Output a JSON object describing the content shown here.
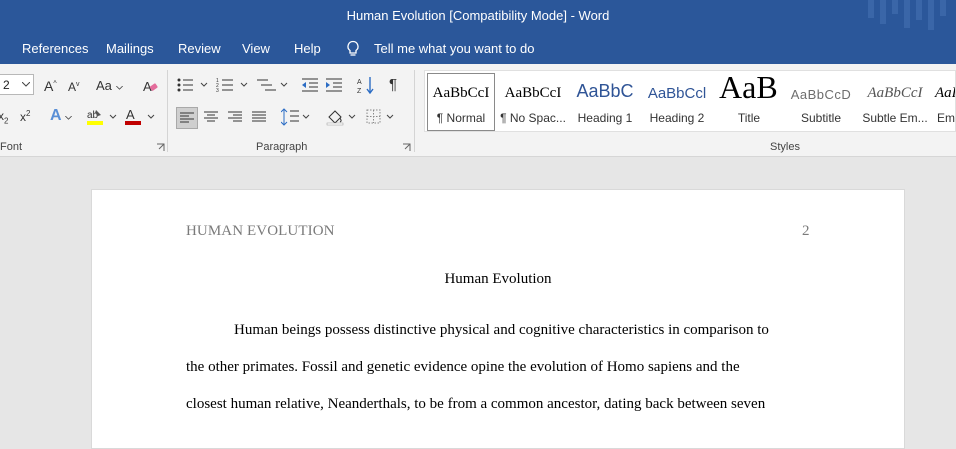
{
  "window": {
    "title": "Human Evolution [Compatibility Mode]  -  Word",
    "title_bar_color": "#2b579a"
  },
  "menu": {
    "items": [
      "References",
      "Mailings",
      "Review",
      "View",
      "Help"
    ],
    "tell_me": "Tell me what you want to do",
    "tell_me_icon": "lightbulb-icon"
  },
  "ribbon": {
    "font_size_value": "2",
    "font_group_label": "Font",
    "paragraph_group_label": "Paragraph",
    "styles_group_label": "Styles",
    "change_case_label": "Aa",
    "pilcrow": "¶",
    "subscript_glyph": "x",
    "subscript_sub": "2",
    "superscript_glyph": "x",
    "superscript_sup": "2",
    "grow_font": "A",
    "shrink_font": "A",
    "font_color_glyph": "A",
    "text_effects_glyph": "A",
    "font_color": "#c00000",
    "highlight_color": "#ffff00",
    "styles": [
      {
        "preview": "AaBbCcI",
        "name": "¶ Normal",
        "selected": true
      },
      {
        "preview": "AaBbCcI",
        "name": "¶ No Spac...",
        "selected": false
      },
      {
        "preview": "AaBbC",
        "name": "Heading 1",
        "selected": false
      },
      {
        "preview": "AaBbCcl",
        "name": "Heading 2",
        "selected": false
      },
      {
        "preview": "AaB",
        "name": "Title",
        "selected": false
      },
      {
        "preview": "AaBbCcD",
        "name": "Subtitle",
        "selected": false
      },
      {
        "preview": "AaBbCcI",
        "name": "Subtle Em...",
        "selected": false
      },
      {
        "preview": "AaBb",
        "name": "Em",
        "selected": false
      }
    ]
  },
  "document": {
    "running_head": "HUMAN EVOLUTION",
    "page_number": "2",
    "title": "Human Evolution",
    "lines": [
      "Human beings possess distinctive physical and cognitive characteristics in comparison to",
      "the other primates. Fossil and genetic evidence opine the evolution of Homo sapiens and the",
      "closest human relative, Neanderthals, to be from a common ancestor, dating back between seven"
    ]
  }
}
